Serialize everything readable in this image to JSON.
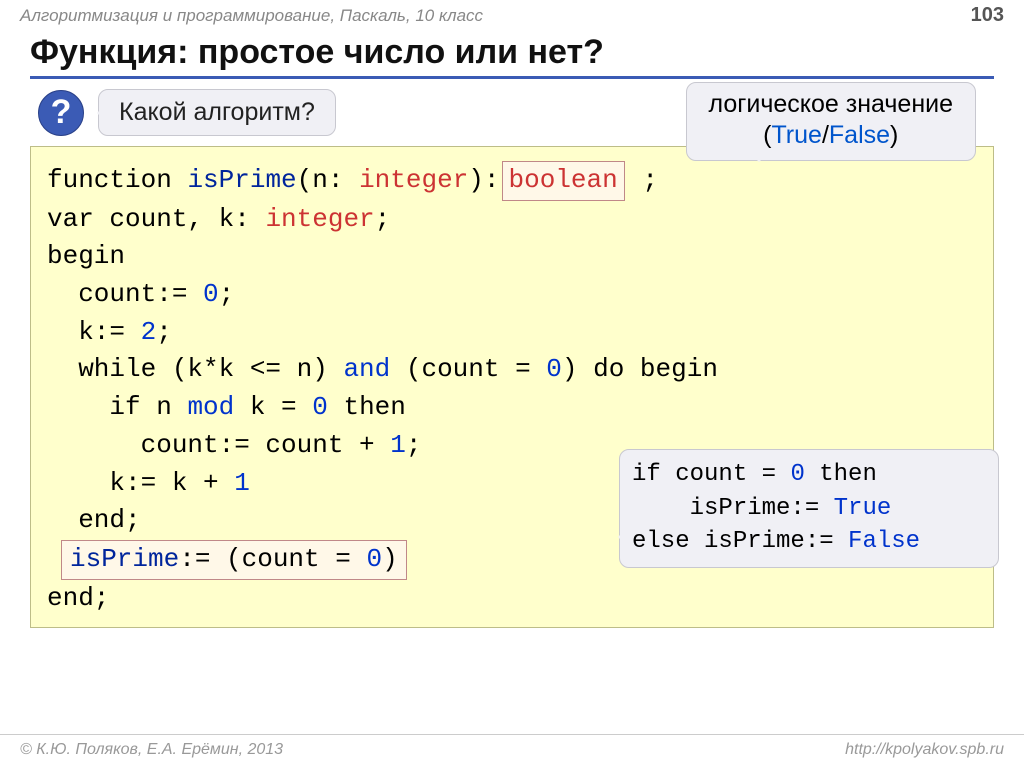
{
  "header": {
    "subject": "Алгоритмизация и программирование, Паскаль, 10 класс",
    "page": "103"
  },
  "title": "Функция: простое число или нет?",
  "question": {
    "mark": "?",
    "text": "Какой алгоритм?"
  },
  "callout_top": {
    "line1": "логическое значение",
    "open": "(",
    "t": "True",
    "sep": "/",
    "f": "False",
    "close": ")"
  },
  "code": {
    "l1a": "function ",
    "l1b": "isPrime",
    "l1c": "(n: ",
    "l1d": "integer",
    "l1e": "):",
    "l1box": "boolean",
    "l1f": " ;",
    "l2a": "var count, k: ",
    "l2b": "integer",
    "l2c": ";",
    "l3": "begin",
    "l4a": "  count:= ",
    "l4b": "0",
    "l4c": ";",
    "l5a": "  k:= ",
    "l5b": "2",
    "l5c": ";",
    "l6a": "  while (k*k <= n) ",
    "l6b": "and",
    "l6c": " (count = ",
    "l6d": "0",
    "l6e": ") do begin",
    "l7a": "    if n ",
    "l7b": "mod",
    "l7c": " k = ",
    "l7d": "0",
    "l7e": " then",
    "l8a": "      count:= count + ",
    "l8b": "1",
    "l8c": ";",
    "l9a": "    k:= k + ",
    "l9b": "1",
    "l10": "  end;",
    "l11a": "isPrime",
    "l11b": ":= (count = ",
    "l11c": "0",
    "l11d": ")",
    "l12": "end;"
  },
  "callout_right": {
    "r1a": "if count = ",
    "r1b": "0",
    "r1c": " then",
    "r2a": "    isPrime:= ",
    "r2true": "True",
    "r3a": "else isPrime:= ",
    "r3false": "False"
  },
  "footer": {
    "left": "© К.Ю. Поляков, Е.А. Ерёмин, 2013",
    "right": "http://kpolyakov.spb.ru"
  }
}
